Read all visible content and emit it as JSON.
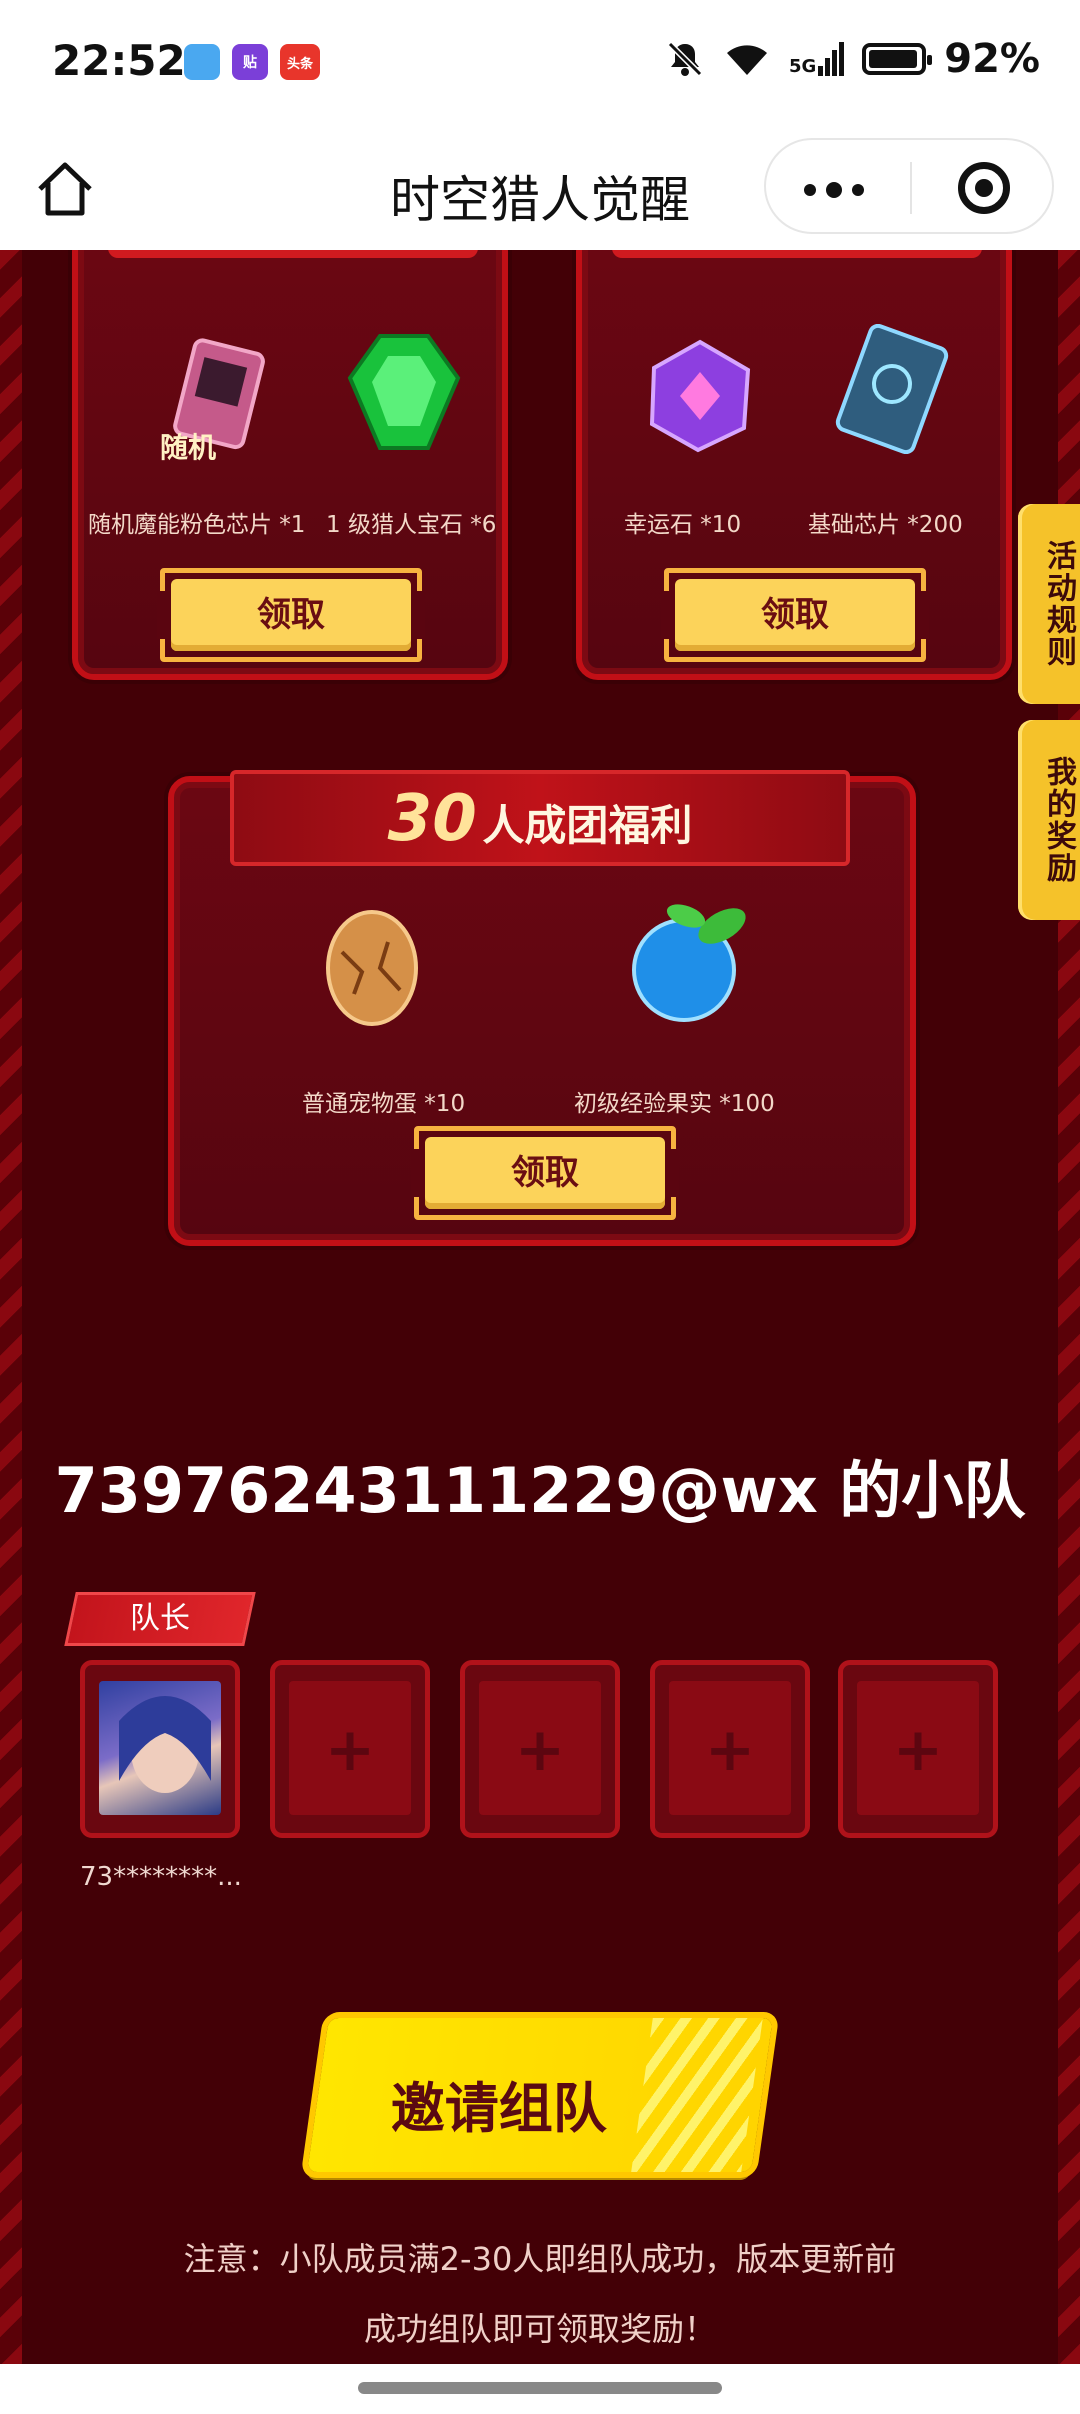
{
  "status_bar": {
    "time": "22:52",
    "notification_badges": [
      "铣",
      "贴",
      "头条"
    ],
    "network": "5G",
    "battery_percent": "92%",
    "battery_level": 0.92
  },
  "title_bar": {
    "title": "时空猎人觉醒"
  },
  "reward_cards_top": [
    {
      "items": [
        {
          "label": "随机魔能粉色芯片 *1",
          "icon": "pink-chip-icon",
          "badge": "随机"
        },
        {
          "label": "1 级猎人宝石 *6",
          "icon": "green-gem-icon"
        }
      ],
      "claim_label": "领取"
    },
    {
      "items": [
        {
          "label": "幸运石 *10",
          "icon": "purple-lucky-stone-icon"
        },
        {
          "label": "基础芯片 *200",
          "icon": "blue-chip-icon"
        }
      ],
      "claim_label": "领取"
    }
  ],
  "side_tabs": {
    "rules": "活动规则",
    "my_rewards": "我的奖励"
  },
  "group_bonus": {
    "count": "30",
    "title": "人成团福利",
    "items": [
      {
        "label": "普通宠物蛋 *10",
        "icon": "pet-egg-icon"
      },
      {
        "label": "初级经验果实 *100",
        "icon": "blue-fruit-icon"
      }
    ],
    "claim_label": "领取"
  },
  "team": {
    "title": "73976243111229@wx 的小队",
    "leader_tag": "队长",
    "leader_name": "73********...",
    "empty_slot_symbol": "+"
  },
  "invite_button": "邀请组队",
  "notice": {
    "line1": "注意：小队成员满2-30人即组队成功，版本更新前",
    "line2": "成功组队即可领取奖励！"
  },
  "colors": {
    "background": "#430006",
    "panel_border": "#c10f16",
    "claim_button": "#fcd35a",
    "invite_button": "#ffe600",
    "side_tab": "#f5c22a"
  }
}
